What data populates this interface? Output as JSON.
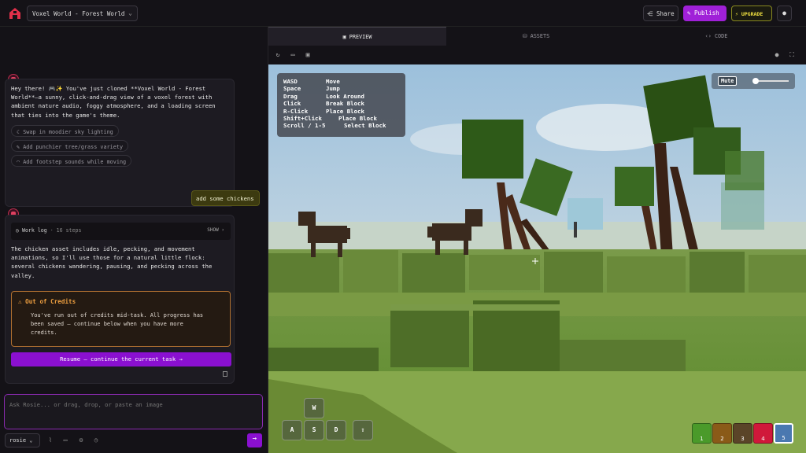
{
  "header": {
    "project": "Voxel World - Forest World",
    "share": "Share",
    "publish": "Publish",
    "upgrade": "UPGRADE"
  },
  "chat": {
    "intro_lines": [
      "Hey there! 🎮✨ You've just cloned **Voxel World - Forest",
      "World**—a sunny, click-and-drag view of a voxel forest with",
      "ambient nature audio, foggy atmosphere, and a loading screen",
      "that ties into the game's theme."
    ],
    "suggestions": [
      "Swap in moodier sky lighting",
      "Add punchier tree/grass variety",
      "Add footstep sounds while moving"
    ],
    "user_message": "add some chickens",
    "worklog_label": "Work log",
    "worklog_steps": "16 steps",
    "worklog_show": "SHOW",
    "reply_lines": [
      "The chicken asset includes idle, pecking, and movement",
      "animations, so I'll use those for a natural little flock:",
      "several chickens wandering, pausing, and pecking across the",
      "valley."
    ],
    "credits_title": "Out of Credits",
    "credits_lines": [
      "You've run out of credits mid-task. All progress has",
      "been saved — continue below when you have more",
      "credits."
    ],
    "resume_label": "Resume — continue the current task",
    "input_placeholder": "Ask Rosie... or drag, drop, or paste an image",
    "model": "rosie"
  },
  "tabs": [
    "PREVIEW",
    "ASSETS",
    "CODE"
  ],
  "help_rows": [
    [
      "WASD",
      "Move"
    ],
    [
      "Space",
      "Jump"
    ],
    [
      "Drag",
      "Look Around"
    ],
    [
      "Click",
      "Break Block"
    ],
    [
      "R-Click",
      "Place Block"
    ],
    [
      "Shift+Click",
      "Place Block"
    ],
    [
      "Scroll / 1-5",
      "Select Block"
    ]
  ],
  "mute_label": "Mute",
  "keys": [
    "W",
    "A",
    "S",
    "D"
  ],
  "hotbar": [
    {
      "num": "1",
      "color": "#4a9a2a"
    },
    {
      "num": "2",
      "color": "#8a5a18"
    },
    {
      "num": "3",
      "color": "#5a4428"
    },
    {
      "num": "4",
      "color": "#d0183a"
    },
    {
      "num": "5",
      "color": "#4a78b0"
    }
  ],
  "icons": [
    "logo-icon",
    "share-icon",
    "publish-icon",
    "upgrade-icon",
    "account-icon",
    "refresh-icon",
    "desktop-icon",
    "frame-icon",
    "record-icon",
    "fullscreen-icon",
    "jump-arrow-icon",
    "send-icon"
  ]
}
